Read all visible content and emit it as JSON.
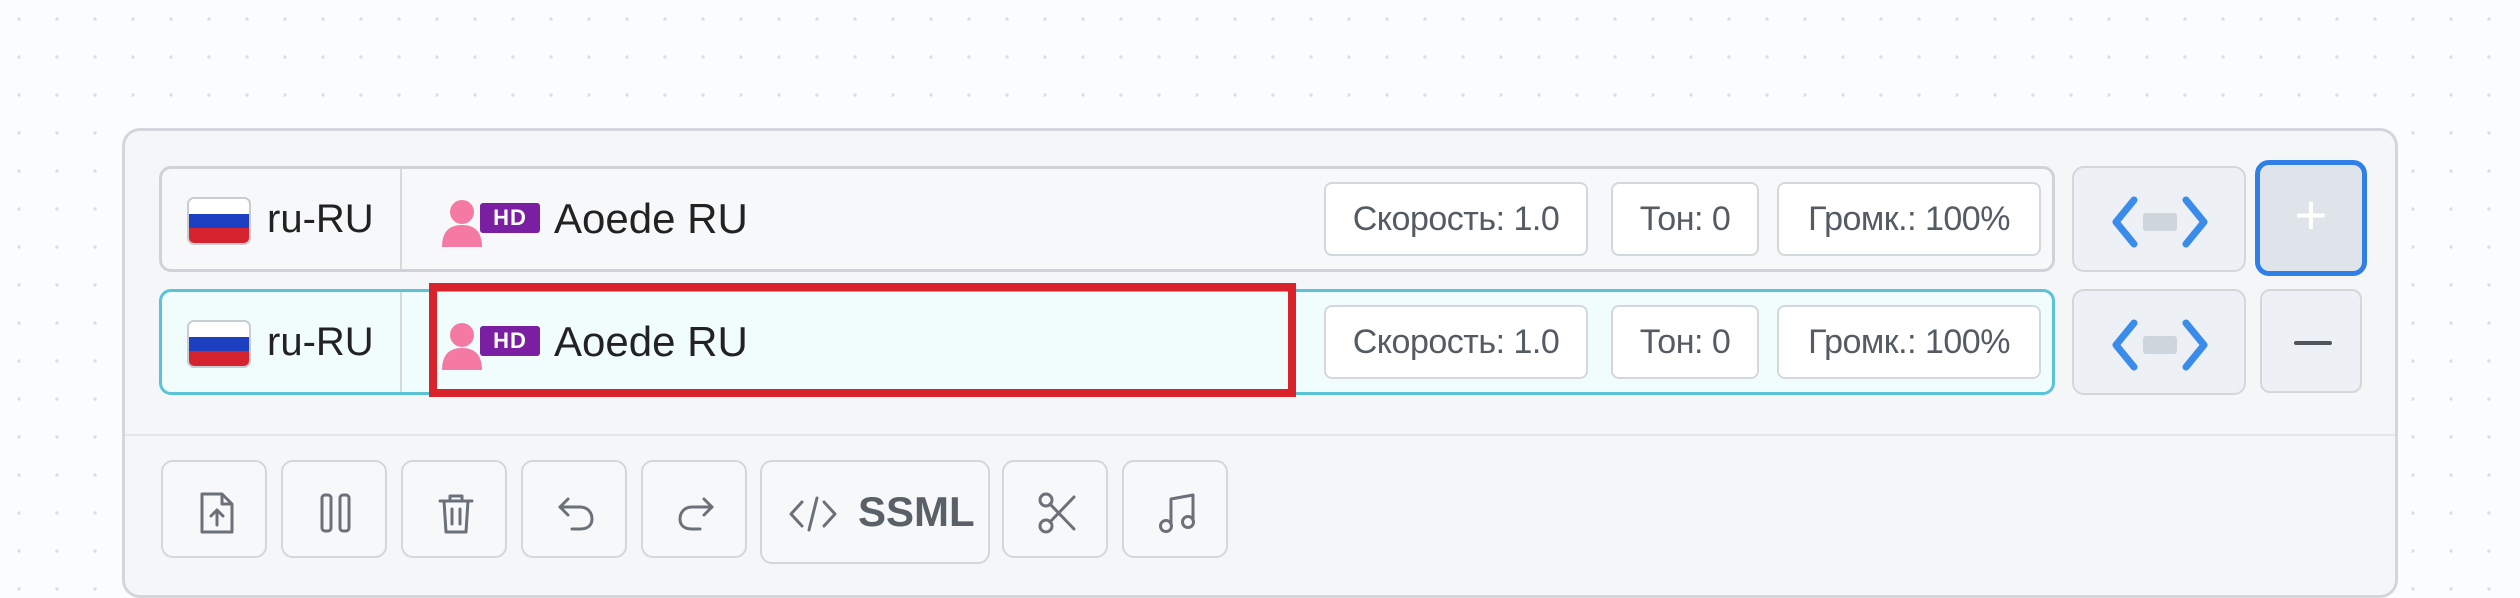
{
  "voices": [
    {
      "lang": "ru-RU",
      "hd_badge": "HD",
      "name": "Aoede RU",
      "speed": "Скорость: 1.0",
      "tone": "Тон: 0",
      "volume": "Громк.: 100%"
    },
    {
      "lang": "ru-RU",
      "hd_badge": "HD",
      "name": "Aoede RU",
      "speed": "Скорость: 1.0",
      "tone": "Тон: 0",
      "volume": "Громк.: 100%"
    }
  ],
  "add_button": "+",
  "toolbar": {
    "ssml_label": "SSML",
    "icons": [
      "file-upload-icon",
      "pause-icon",
      "trash-icon",
      "undo-icon",
      "redo-icon",
      "code-icon",
      "scissors-icon",
      "music-note-icon"
    ]
  },
  "colors": {
    "accent": "#2f7fe6",
    "active_row_border": "#5bc3d6",
    "highlight": "#d8232a",
    "hd_badge": "#7a1fa2",
    "voice_icon": "#f47aa3"
  }
}
